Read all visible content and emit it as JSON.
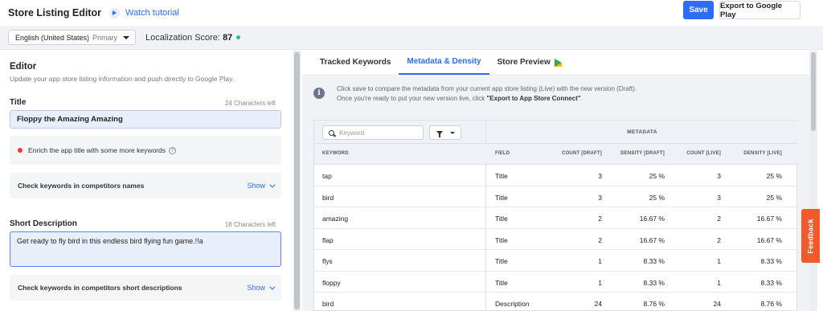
{
  "header": {
    "title": "Store Listing Editor",
    "watch_tutorial": "Watch tutorial",
    "save_label": "Save",
    "export_label": "Export to Google Play"
  },
  "langbar": {
    "language": "English (United States)",
    "primary": "Primary",
    "score_label": "Localization Score:",
    "score_value": "87"
  },
  "editor": {
    "heading": "Editor",
    "subheading": "Update your app store listing information and push directly to Google Play.",
    "title_label": "Title",
    "title_chars_left": "24 Characters left",
    "title_value": "Floppy the Amazing Amazing",
    "title_hint": "Enrich the app title with some more keywords",
    "check_competitors_names": "Check keywords in competitors names",
    "show_label": "Show",
    "short_desc_label": "Short Description",
    "short_desc_chars_left": "18 Characters left",
    "short_desc_value": "Get ready to fly bird in this endless bird flying fun game.!!a",
    "check_competitors_short": "Check keywords in competitors short descriptions"
  },
  "tabs": {
    "tracked": "Tracked Keywords",
    "metadata": "Metadata & Density",
    "preview": "Store Preview"
  },
  "info": {
    "line1": "Click save to compare the metadata from your current app store listing (Live) with the new version (Draft).",
    "line2_pre": "Once you're ready to put your new version live, click ",
    "line2_bold": "\"Export to App Store Connect\"",
    "line2_post": "."
  },
  "table": {
    "search_placeholder": "Keyword",
    "metadata_header": "METADATA",
    "columns": {
      "keyword": "KEYWORD",
      "field": "FIELD",
      "count_draft": "COUNT [DRAFT]",
      "density_draft": "DENSITY [DRAFT]",
      "count_live": "COUNT [LIVE]",
      "density_live": "DENSITY [LIVE]"
    },
    "rows": [
      {
        "keyword": "tap",
        "field": "Title",
        "count_draft": "3",
        "density_draft": "25 %",
        "count_live": "3",
        "density_live": "25 %"
      },
      {
        "keyword": "bird",
        "field": "Title",
        "count_draft": "3",
        "density_draft": "25 %",
        "count_live": "3",
        "density_live": "25 %"
      },
      {
        "keyword": "amazing",
        "field": "Title",
        "count_draft": "2",
        "density_draft": "16.67 %",
        "count_live": "2",
        "density_live": "16.67 %"
      },
      {
        "keyword": "flap",
        "field": "Title",
        "count_draft": "2",
        "density_draft": "16.67 %",
        "count_live": "2",
        "density_live": "16.67 %"
      },
      {
        "keyword": "flys",
        "field": "Title",
        "count_draft": "1",
        "density_draft": "8.33 %",
        "count_live": "1",
        "density_live": "8.33 %"
      },
      {
        "keyword": "floppy",
        "field": "Title",
        "count_draft": "1",
        "density_draft": "8.33 %",
        "count_live": "1",
        "density_live": "8.33 %"
      },
      {
        "keyword": "bird",
        "field": "Description",
        "count_draft": "24",
        "density_draft": "8.76 %",
        "count_live": "24",
        "density_live": "8.76 %"
      }
    ]
  },
  "feedback_label": "Feedback",
  "colors": {
    "accent": "#2d6df6",
    "score_dot": "#2fc07f",
    "hint_dot": "#e53935",
    "feedback": "#ef5b2b"
  }
}
